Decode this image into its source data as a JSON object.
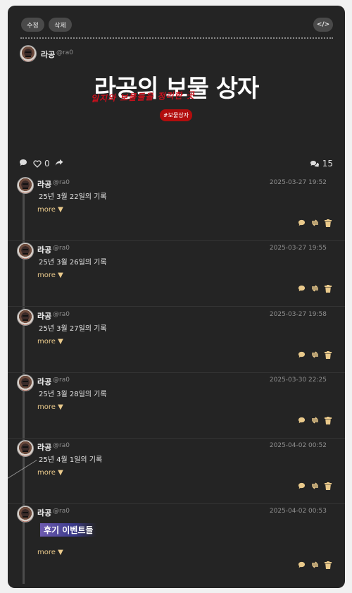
{
  "toolbar": {
    "edit_label": "수정",
    "delete_label": "삭제",
    "code_label": "</>"
  },
  "post": {
    "author": "라공",
    "handle": "@ra0",
    "title": "라공의 보물 상자",
    "scribble": "일지와 보물들을 정리한 곳",
    "hashtag": "#보물상자",
    "like_count": "0",
    "reply_count": "15"
  },
  "replies": [
    {
      "author": "라공",
      "handle": "@ra0",
      "date": "2025-03-27 19:52",
      "text": "25년 3월 22일의 기록",
      "more": "more ▼"
    },
    {
      "author": "라공",
      "handle": "@ra0",
      "date": "2025-03-27 19:55",
      "text": "25년 3월 26일의 기록",
      "more": "more ▼"
    },
    {
      "author": "라공",
      "handle": "@ra0",
      "date": "2025-03-27 19:58",
      "text": "25년 3월 27일의 기록",
      "more": "more ▼"
    },
    {
      "author": "라공",
      "handle": "@ra0",
      "date": "2025-03-30 22:25",
      "text": "25년 3월 28일의 기록",
      "more": "more ▼"
    },
    {
      "author": "라공",
      "handle": "@ra0",
      "date": "2025-04-02 00:52",
      "text": "25년 4월 1일의 기록",
      "more": "more ▼"
    },
    {
      "author": "라공",
      "handle": "@ra0",
      "date": "2025-04-02 00:53",
      "text": "후기 이벤트들",
      "more": "more ▼"
    }
  ],
  "colors": {
    "accent": "#e9c98b",
    "hashtag_bg": "#b20d0d",
    "card_bg": "#242424"
  },
  "icons": [
    "comment-icon",
    "heart-icon",
    "share-icon",
    "comments-icon",
    "retweet-icon",
    "trash-icon",
    "code-icon"
  ]
}
